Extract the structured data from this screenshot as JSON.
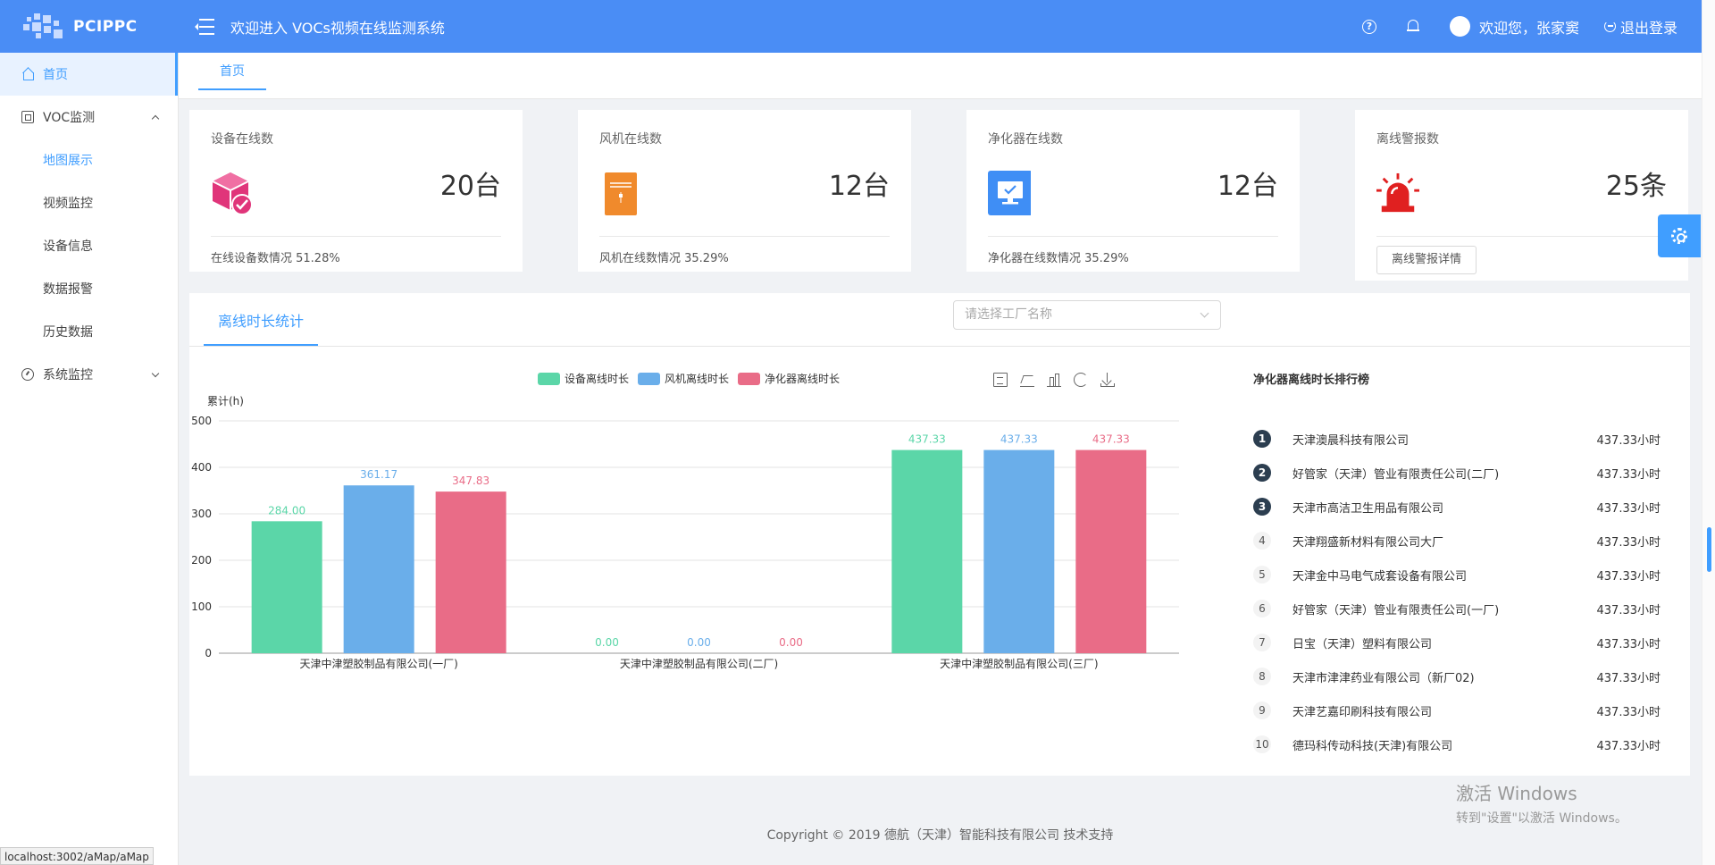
{
  "header": {
    "logo_text": "PCIPPC",
    "title": "欢迎进入 VOCs视频在线监测系统",
    "help_glyph": "?",
    "welcome": "欢迎您，张家窦",
    "logout": "退出登录"
  },
  "sidebar": {
    "home": "首页",
    "voc_group": "VOC监测",
    "voc_items": [
      "地图展示",
      "视频监控",
      "设备信息",
      "数据报警",
      "历史数据"
    ],
    "system_group": "系统监控"
  },
  "tabs": {
    "home": "首页"
  },
  "cards": [
    {
      "title": "设备在线数",
      "value": "20台",
      "foot": "在线设备数情况 51.28%"
    },
    {
      "title": "风机在线数",
      "value": "12台",
      "foot": "风机在线数情况 35.29%"
    },
    {
      "title": "净化器在线数",
      "value": "12台",
      "foot": "净化器在线数情况 35.29%"
    },
    {
      "title": "离线警报数",
      "value": "25条",
      "button": "离线警报详情"
    }
  ],
  "panel": {
    "tab": "离线时长统计",
    "select_placeholder": "请选择工厂名称"
  },
  "colors": {
    "primary": "#409eff",
    "header": "#4a8df5",
    "device": "#5bd6a8",
    "fan": "#6aaeea",
    "purifier": "#e96c87",
    "alarm_red": "#e02020",
    "orange": "#f08a2c",
    "magenta": "#e0357a"
  },
  "chart_data": {
    "type": "bar",
    "ylabel": "累计(h)",
    "ylim": [
      0,
      500
    ],
    "yticks": [
      0,
      100,
      200,
      300,
      400,
      500
    ],
    "categories": [
      "天津中津塑胶制品有限公司(一厂)",
      "天津中津塑胶制品有限公司(二厂)",
      "天津中津塑胶制品有限公司(三厂)"
    ],
    "series": [
      {
        "name": "设备离线时长",
        "values": [
          284.0,
          0.0,
          437.33
        ],
        "color": "#5bd6a8"
      },
      {
        "name": "风机离线时长",
        "values": [
          361.17,
          0.0,
          437.33
        ],
        "color": "#6aaeea"
      },
      {
        "name": "净化器离线时长",
        "values": [
          347.83,
          0.0,
          437.33
        ],
        "color": "#e96c87"
      }
    ],
    "legend": "top-center",
    "grid": true
  },
  "ranking": {
    "title": "净化器离线时长排行榜",
    "items": [
      {
        "rank": "1",
        "name": "天津澳晨科技有限公司",
        "value": "437.33小时"
      },
      {
        "rank": "2",
        "name": "好管家（天津）管业有限责任公司(二厂)",
        "value": "437.33小时"
      },
      {
        "rank": "3",
        "name": "天津市高洁卫生用品有限公司",
        "value": "437.33小时"
      },
      {
        "rank": "4",
        "name": "天津翔盛新材料有限公司大厂",
        "value": "437.33小时"
      },
      {
        "rank": "5",
        "name": "天津金中马电气成套设备有限公司",
        "value": "437.33小时"
      },
      {
        "rank": "6",
        "name": "好管家（天津）管业有限责任公司(一厂)",
        "value": "437.33小时"
      },
      {
        "rank": "7",
        "name": "日宝（天津）塑料有限公司",
        "value": "437.33小时"
      },
      {
        "rank": "8",
        "name": "天津市津津药业有限公司（新厂02)",
        "value": "437.33小时"
      },
      {
        "rank": "9",
        "name": "天津艺嘉印刷科技有限公司",
        "value": "437.33小时"
      },
      {
        "rank": "10",
        "name": "德玛科传动科技(天津)有限公司",
        "value": "437.33小时"
      }
    ]
  },
  "footer": {
    "copyright": "Copyright © 2019 德航（天津）智能科技有限公司 技术支持"
  },
  "watermark": {
    "line1": "激活 Windows",
    "line2": "转到\"设置\"以激活 Windows。"
  },
  "status_url": "localhost:3002/aMap/aMap",
  "icons": {
    "menu": "menu-fold-icon",
    "help": "help-icon",
    "bell": "bell-icon",
    "logout": "logout-icon",
    "home": "home-icon",
    "voc": "monitor-icon",
    "system": "gauge-icon",
    "device": "cube-check-icon",
    "fan": "fan-cabinet-icon",
    "purifier": "purifier-screen-icon",
    "alarm": "alarm-light-icon",
    "settings": "gear-icon"
  }
}
